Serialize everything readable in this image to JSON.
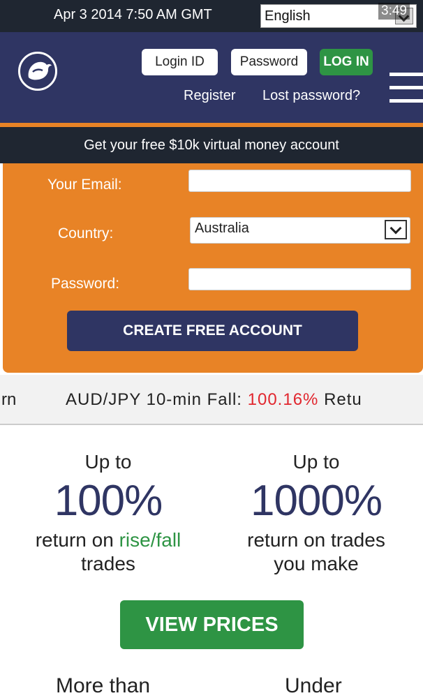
{
  "topbar": {
    "datetime": "Apr 3 2014 7:50 AM GMT",
    "language": "English",
    "clock": "3:49"
  },
  "header": {
    "login_id": "Login ID",
    "password": "Password",
    "login_button": "LOG IN",
    "register_link": "Register",
    "lost_password_link": "Lost password?"
  },
  "promo": {
    "text": "Get your free $10k virtual money account"
  },
  "signup_form": {
    "email_label": "Your Email:",
    "email_value": "",
    "country_label": "Country:",
    "country_value": "Australia",
    "password_label": "Password:",
    "password_value": "",
    "submit_label": "CREATE FREE ACCOUNT"
  },
  "ticker": {
    "prev_tail": "rn",
    "instrument": "AUD/JPY 10-min Fall:",
    "percent": "100.16%",
    "next_head": "Retu",
    "percent_color": "#e1272f"
  },
  "stats": [
    {
      "upto": "Up to",
      "value": "100%",
      "desc_before": "return on ",
      "desc_highlight": "rise/fall",
      "desc_after": "trades"
    },
    {
      "upto": "Up to",
      "value": "1000%",
      "desc_before": "return on trades",
      "desc_highlight": "",
      "desc_after": "you make"
    }
  ],
  "view_prices_label": "VIEW PRICES",
  "bottom": {
    "left": "More than",
    "right": "Under"
  },
  "colors": {
    "navy": "#2f3563",
    "dark": "#1f2631",
    "orange": "#e88326",
    "green": "#2e9444",
    "red": "#e1272f"
  }
}
